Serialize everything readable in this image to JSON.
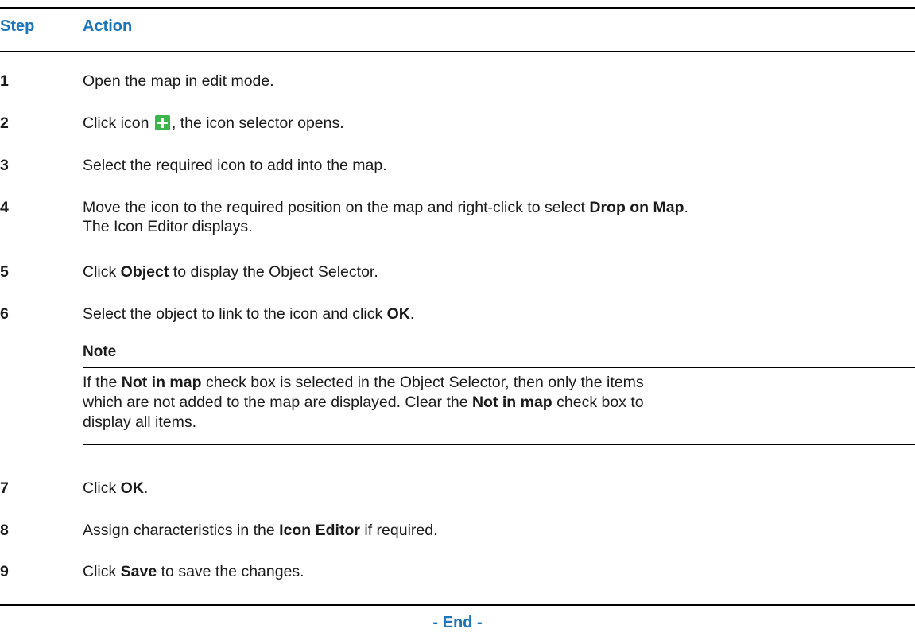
{
  "header": {
    "step_label": "Step",
    "action_label": "Action"
  },
  "steps": [
    {
      "num": "1",
      "text": "Open the map in edit mode."
    },
    {
      "num": "2",
      "pre": "Click icon ",
      "icon": "green-plus-icon",
      "post": ", the icon selector opens."
    },
    {
      "num": "3",
      "text": "Select the required icon to add into the map."
    },
    {
      "num": "4",
      "pre": "Move the icon to the required position on the map and right-click to select ",
      "bold": "Drop on Map",
      "post": ".",
      "line2": "The Icon Editor displays."
    },
    {
      "num": "5",
      "pre": "Click ",
      "bold": "Object",
      "post": " to display the Object Selector."
    },
    {
      "num": "6",
      "pre": "Select the object to link to the icon and click ",
      "bold": "OK",
      "post": "."
    },
    {
      "num": "7",
      "pre": "Click ",
      "bold": "OK",
      "post": "."
    },
    {
      "num": "8",
      "pre": "Assign characteristics in the ",
      "bold": "Icon Editor",
      "post": " if required."
    },
    {
      "num": "9",
      "pre": "Click ",
      "bold": "Save",
      "post": " to save the changes."
    }
  ],
  "note": {
    "title": "Note",
    "p1": "If the ",
    "b1": "Not in map",
    "p2": " check box is selected in the Object Selector, then only the items which are not added to the map are displayed. Clear the ",
    "b2": "Not in map",
    "p3": " check box to display all items."
  },
  "footer": {
    "end_label": "- End -"
  },
  "colors": {
    "heading_blue": "#1a75bb",
    "icon_green": "#3cb54a"
  }
}
